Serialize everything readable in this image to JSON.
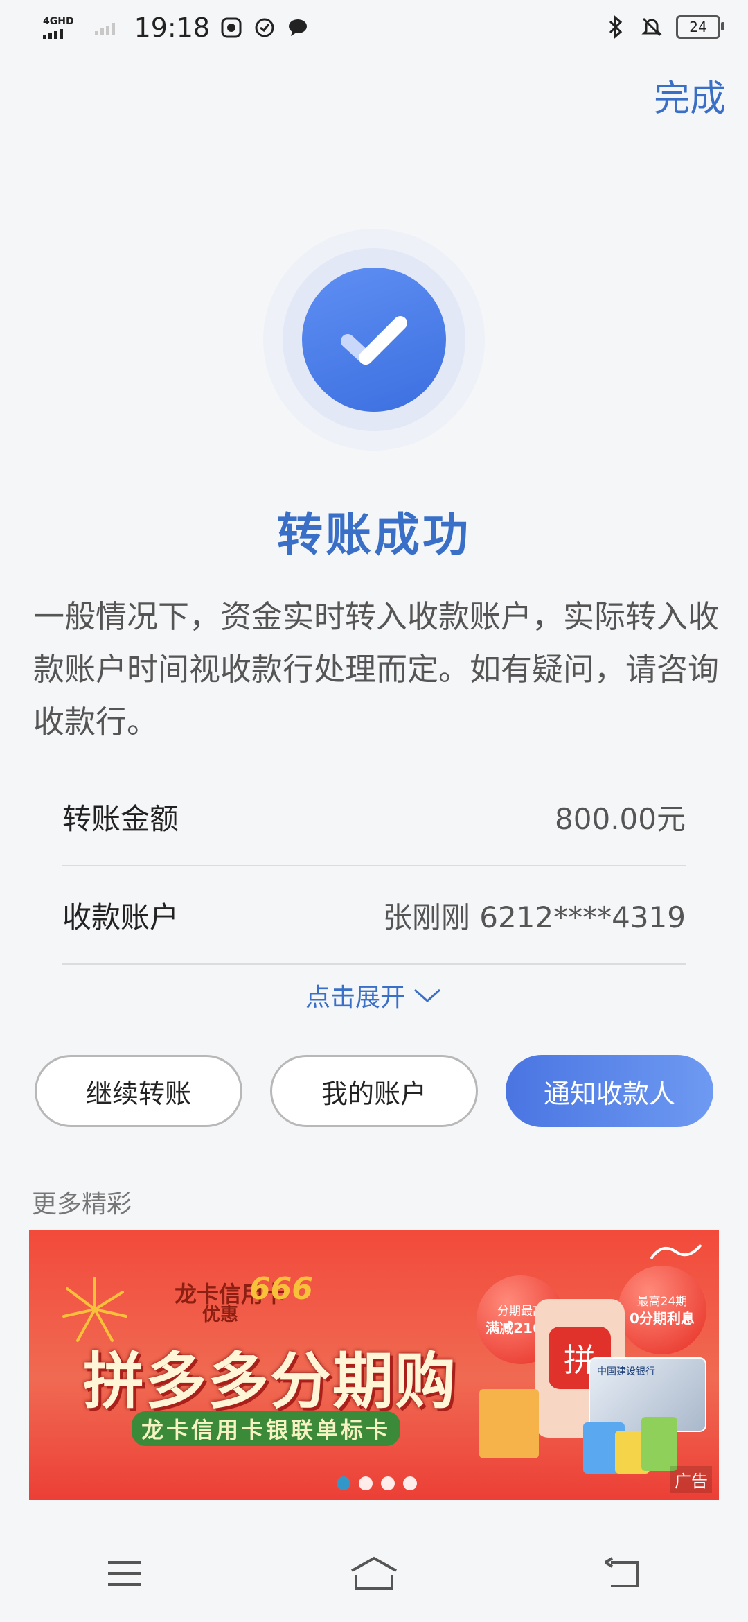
{
  "status_bar": {
    "network": "4GHD",
    "time": "19:18",
    "battery": "24"
  },
  "header": {
    "done_label": "完成"
  },
  "result": {
    "title": "转账成功",
    "description": "一般情况下，资金实时转入收款账户，实际转入收款账户时间视收款行处理而定。如有疑问，请咨询收款行。"
  },
  "details": [
    {
      "label": "转账金额",
      "value": "800.00元"
    },
    {
      "label": "收款账户",
      "value": "张刚刚 6212****4319"
    }
  ],
  "expand_label": "点击展开",
  "actions": {
    "continue": "继续转账",
    "my_account": "我的账户",
    "notify": "通知收款人"
  },
  "more": {
    "title": "更多精彩"
  },
  "banner": {
    "sub": "龙卡信用卡",
    "promo_prefix": "优惠",
    "promo": "666",
    "main": "拼多多分期购",
    "cardline": "龙卡信用卡银联单标卡",
    "balloon1_top": "分期最高",
    "balloon1_main": "满减216元",
    "balloon2_top": "最高24期",
    "balloon2_main": "0分期利息",
    "card_bank": "中国建设银行",
    "ad_tag": "广告",
    "active_dot": 0,
    "dot_count": 4
  },
  "colors": {
    "accent": "#3a6fc8",
    "primary_button": "#4a75e2",
    "banner_red": "#f24a3b"
  },
  "nav": {
    "icons": [
      "menu-icon",
      "home-icon",
      "back-icon"
    ]
  }
}
